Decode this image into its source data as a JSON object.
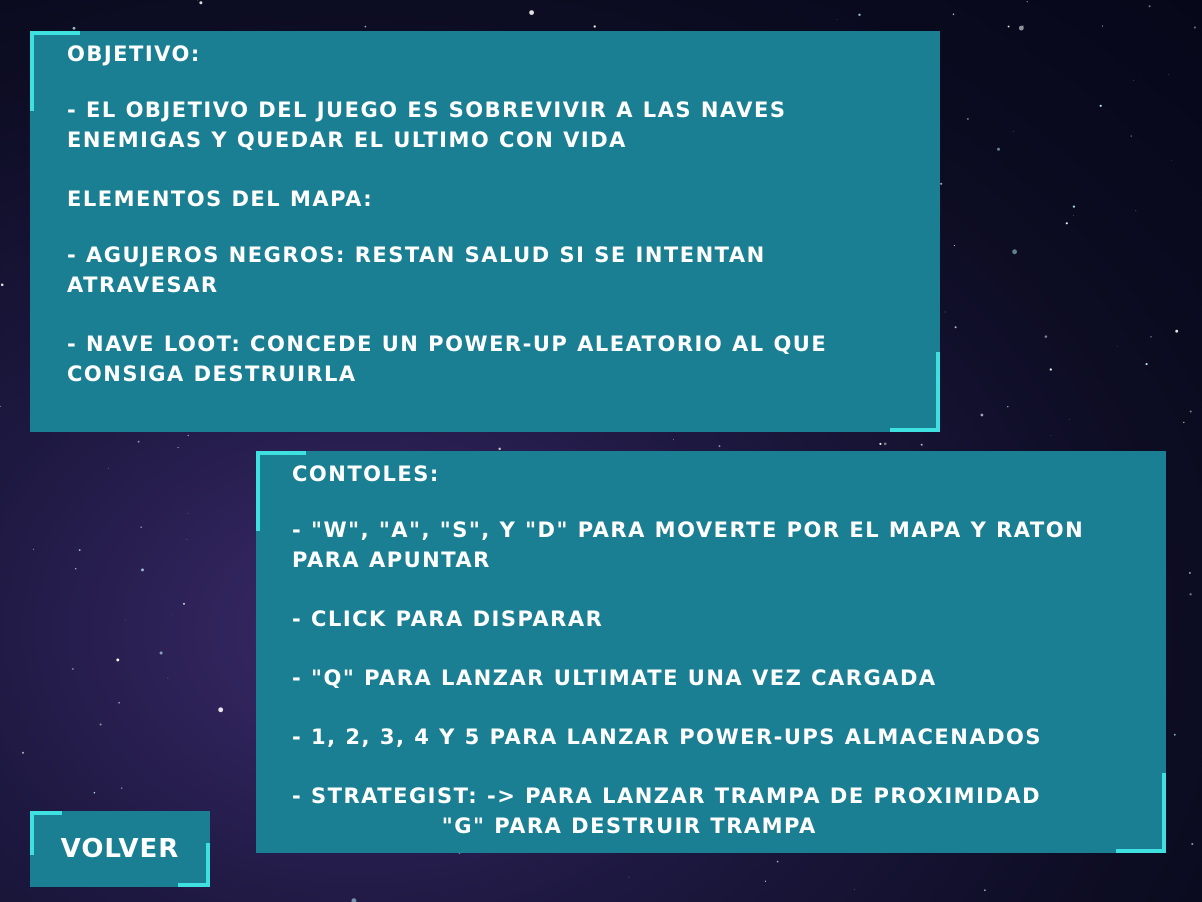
{
  "objective_panel": {
    "heading": "OBJETIVO:",
    "objective_line": "- EL OBJETIVO DEL JUEGO ES SOBREVIVIR A LAS NAVES\nENEMIGAS Y QUEDAR EL ULTIMO CON VIDA",
    "map_heading": "ELEMENTOS DEL MAPA:",
    "black_holes": "- AGUJEROS NEGROS: RESTAN SALUD SI SE INTENTAN\nATRAVESAR",
    "loot_ship": "- NAVE LOOT: CONCEDE UN POWER-UP ALEATORIO AL QUE\nCONSIGA DESTRUIRLA"
  },
  "controls_panel": {
    "heading": "CONTOLES:",
    "move": "- \"W\", \"A\", \"S\", Y \"D\" PARA MOVERTE POR EL MAPA Y RATON\nPARA APUNTAR",
    "shoot": "- CLICK PARA DISPARAR",
    "ultimate": "- \"Q\" PARA LANZAR ULTIMATE UNA VEZ CARGADA",
    "powerups": "- 1, 2, 3, 4 Y 5 PARA LANZAR POWER-UPS ALMACENADOS",
    "strategist": "- STRATEGIST: -> PARA LANZAR TRAMPA DE PROXIMIDAD\n                 \"G\" PARA DESTRUIR TRAMPA"
  },
  "back_button": {
    "label": "VOLVER"
  },
  "colors": {
    "panel": "#1a7f92",
    "accent": "#3fe0e0",
    "text": "#ffffff"
  }
}
